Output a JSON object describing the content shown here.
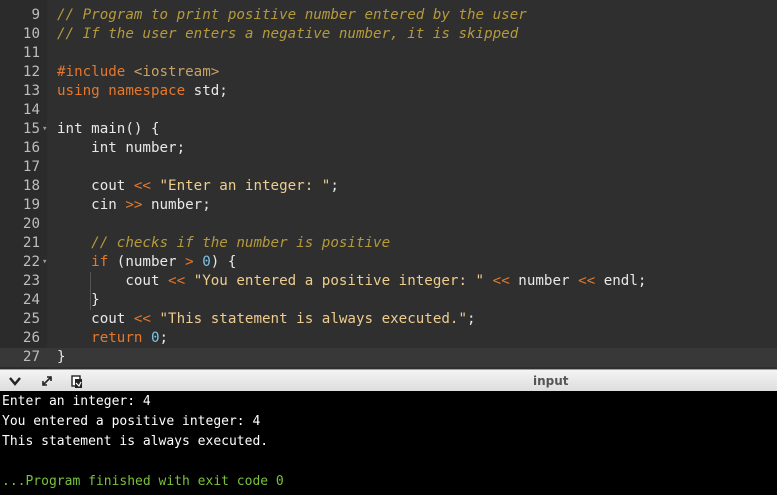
{
  "editor": {
    "lines": [
      {
        "n": "9",
        "html": "<span class=\"cm\">// Program to print positive number entered by the user</span>"
      },
      {
        "n": "10",
        "html": "<span class=\"cm\">// If the user enters a negative number, it is skipped</span>"
      },
      {
        "n": "11",
        "html": ""
      },
      {
        "n": "12",
        "html": "<span class=\"pp\">#include</span> <span class=\"inc\">&lt;iostream&gt;</span>"
      },
      {
        "n": "13",
        "html": "<span class=\"kw\">using</span> <span class=\"kw\">namespace</span> std;"
      },
      {
        "n": "14",
        "html": ""
      },
      {
        "n": "15",
        "html": "int main() {",
        "fold": true
      },
      {
        "n": "16",
        "html": "    int number;"
      },
      {
        "n": "17",
        "html": ""
      },
      {
        "n": "18",
        "html": "    cout <span class=\"op\">&lt;&lt;</span> <span class=\"str\">\"Enter an integer: \"</span>;"
      },
      {
        "n": "19",
        "html": "    cin <span class=\"op\">&gt;&gt;</span> number;"
      },
      {
        "n": "20",
        "html": ""
      },
      {
        "n": "21",
        "html": "    <span class=\"cm\">// checks if the number is positive</span>"
      },
      {
        "n": "22",
        "html": "    <span class=\"kw\">if</span> (number <span class=\"op\">&gt;</span> <span class=\"num\">0</span>) {",
        "fold": true
      },
      {
        "n": "23",
        "html": "        cout <span class=\"op\">&lt;&lt;</span> <span class=\"str\">\"You entered a positive integer: \"</span> <span class=\"op\">&lt;&lt;</span> number <span class=\"op\">&lt;&lt;</span> endl;"
      },
      {
        "n": "24",
        "html": "    }"
      },
      {
        "n": "25",
        "html": "    cout <span class=\"op\">&lt;&lt;</span> <span class=\"str\">\"This statement is always executed.\"</span>;"
      },
      {
        "n": "26",
        "html": "    <span class=\"kw\">return</span> <span class=\"num\">0</span>;"
      },
      {
        "n": "27",
        "html": "}",
        "active": true
      }
    ]
  },
  "toolbar": {
    "title": "input",
    "icons": [
      "chevron-down-icon",
      "expand-icon",
      "copy-icon"
    ]
  },
  "console": {
    "lines": [
      "Enter an integer: 4",
      "You entered a positive integer: 4",
      "This statement is always executed.",
      ""
    ],
    "exit_line": "...Program finished with exit code 0"
  },
  "colors": {
    "editor_bg": "#2f2f2f",
    "comment": "#b59a3d",
    "keyword": "#e5782c",
    "string": "#eecd8e",
    "number": "#7fc3e3",
    "exit_text": "#79c23c"
  }
}
